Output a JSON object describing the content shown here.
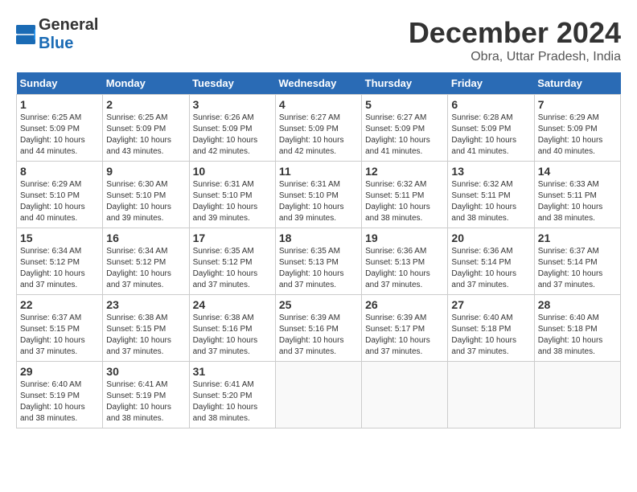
{
  "header": {
    "logo_general": "General",
    "logo_blue": "Blue",
    "title": "December 2024",
    "subtitle": "Obra, Uttar Pradesh, India"
  },
  "weekdays": [
    "Sunday",
    "Monday",
    "Tuesday",
    "Wednesday",
    "Thursday",
    "Friday",
    "Saturday"
  ],
  "weeks": [
    [
      {
        "day": "1",
        "sunrise": "6:25 AM",
        "sunset": "5:09 PM",
        "daylight": "10 hours and 44 minutes."
      },
      {
        "day": "2",
        "sunrise": "6:25 AM",
        "sunset": "5:09 PM",
        "daylight": "10 hours and 43 minutes."
      },
      {
        "day": "3",
        "sunrise": "6:26 AM",
        "sunset": "5:09 PM",
        "daylight": "10 hours and 42 minutes."
      },
      {
        "day": "4",
        "sunrise": "6:27 AM",
        "sunset": "5:09 PM",
        "daylight": "10 hours and 42 minutes."
      },
      {
        "day": "5",
        "sunrise": "6:27 AM",
        "sunset": "5:09 PM",
        "daylight": "10 hours and 41 minutes."
      },
      {
        "day": "6",
        "sunrise": "6:28 AM",
        "sunset": "5:09 PM",
        "daylight": "10 hours and 41 minutes."
      },
      {
        "day": "7",
        "sunrise": "6:29 AM",
        "sunset": "5:09 PM",
        "daylight": "10 hours and 40 minutes."
      }
    ],
    [
      {
        "day": "8",
        "sunrise": "6:29 AM",
        "sunset": "5:10 PM",
        "daylight": "10 hours and 40 minutes."
      },
      {
        "day": "9",
        "sunrise": "6:30 AM",
        "sunset": "5:10 PM",
        "daylight": "10 hours and 39 minutes."
      },
      {
        "day": "10",
        "sunrise": "6:31 AM",
        "sunset": "5:10 PM",
        "daylight": "10 hours and 39 minutes."
      },
      {
        "day": "11",
        "sunrise": "6:31 AM",
        "sunset": "5:10 PM",
        "daylight": "10 hours and 39 minutes."
      },
      {
        "day": "12",
        "sunrise": "6:32 AM",
        "sunset": "5:11 PM",
        "daylight": "10 hours and 38 minutes."
      },
      {
        "day": "13",
        "sunrise": "6:32 AM",
        "sunset": "5:11 PM",
        "daylight": "10 hours and 38 minutes."
      },
      {
        "day": "14",
        "sunrise": "6:33 AM",
        "sunset": "5:11 PM",
        "daylight": "10 hours and 38 minutes."
      }
    ],
    [
      {
        "day": "15",
        "sunrise": "6:34 AM",
        "sunset": "5:12 PM",
        "daylight": "10 hours and 37 minutes."
      },
      {
        "day": "16",
        "sunrise": "6:34 AM",
        "sunset": "5:12 PM",
        "daylight": "10 hours and 37 minutes."
      },
      {
        "day": "17",
        "sunrise": "6:35 AM",
        "sunset": "5:12 PM",
        "daylight": "10 hours and 37 minutes."
      },
      {
        "day": "18",
        "sunrise": "6:35 AM",
        "sunset": "5:13 PM",
        "daylight": "10 hours and 37 minutes."
      },
      {
        "day": "19",
        "sunrise": "6:36 AM",
        "sunset": "5:13 PM",
        "daylight": "10 hours and 37 minutes."
      },
      {
        "day": "20",
        "sunrise": "6:36 AM",
        "sunset": "5:14 PM",
        "daylight": "10 hours and 37 minutes."
      },
      {
        "day": "21",
        "sunrise": "6:37 AM",
        "sunset": "5:14 PM",
        "daylight": "10 hours and 37 minutes."
      }
    ],
    [
      {
        "day": "22",
        "sunrise": "6:37 AM",
        "sunset": "5:15 PM",
        "daylight": "10 hours and 37 minutes."
      },
      {
        "day": "23",
        "sunrise": "6:38 AM",
        "sunset": "5:15 PM",
        "daylight": "10 hours and 37 minutes."
      },
      {
        "day": "24",
        "sunrise": "6:38 AM",
        "sunset": "5:16 PM",
        "daylight": "10 hours and 37 minutes."
      },
      {
        "day": "25",
        "sunrise": "6:39 AM",
        "sunset": "5:16 PM",
        "daylight": "10 hours and 37 minutes."
      },
      {
        "day": "26",
        "sunrise": "6:39 AM",
        "sunset": "5:17 PM",
        "daylight": "10 hours and 37 minutes."
      },
      {
        "day": "27",
        "sunrise": "6:40 AM",
        "sunset": "5:18 PM",
        "daylight": "10 hours and 37 minutes."
      },
      {
        "day": "28",
        "sunrise": "6:40 AM",
        "sunset": "5:18 PM",
        "daylight": "10 hours and 38 minutes."
      }
    ],
    [
      {
        "day": "29",
        "sunrise": "6:40 AM",
        "sunset": "5:19 PM",
        "daylight": "10 hours and 38 minutes."
      },
      {
        "day": "30",
        "sunrise": "6:41 AM",
        "sunset": "5:19 PM",
        "daylight": "10 hours and 38 minutes."
      },
      {
        "day": "31",
        "sunrise": "6:41 AM",
        "sunset": "5:20 PM",
        "daylight": "10 hours and 38 minutes."
      },
      null,
      null,
      null,
      null
    ]
  ]
}
